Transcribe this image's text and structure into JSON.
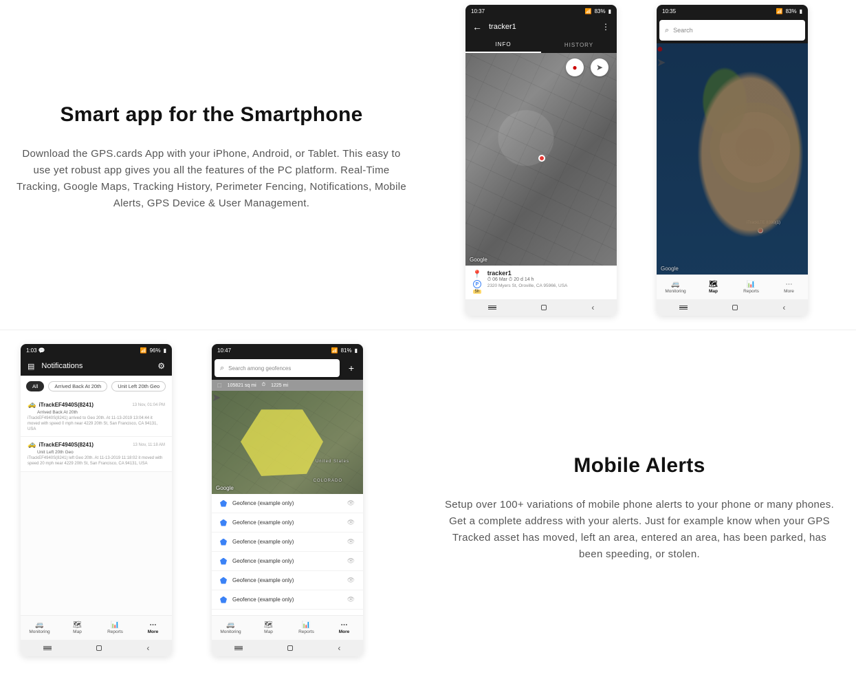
{
  "sections": {
    "s1": {
      "heading": "Smart app for the Smartphone",
      "paragraph": "Download the GPS.cards App with your iPhone, Android, or Tablet. This easy to use yet robust app gives you all the features of the PC platform. Real-Time Tracking, Google Maps, Tracking History, Perimeter Fencing, Notifications, Mobile Alerts, GPS Device & User Management."
    },
    "s2": {
      "heading": "Mobile Alerts",
      "paragraph": "Setup over 100+ variations of mobile phone alerts to your phone or many phones. Get a complete address with your alerts. Just for example know when your GPS Tracked asset has moved, left an area, entered an area, has been parked, has been speeding, or stolen."
    }
  },
  "phone1": {
    "status_time": "10:37",
    "status_batt": "83%",
    "header_title": "tracker1",
    "tab_info": "INFO",
    "tab_history": "HISTORY",
    "map_attr": "Google",
    "card_name": "tracker1",
    "card_meta": "⏱ 06 Mar  ⏱ 20 d 14 h",
    "card_addr": "2320 Myers St, Oroville, CA 95966, USA",
    "card_badge": "5h",
    "park_p": "P"
  },
  "phone2": {
    "status_time": "10:35",
    "status_batt": "83%",
    "search_placeholder": "Search",
    "map_attr": "Google",
    "tracker_label": "iTrackLTE 8390(1)",
    "nav": {
      "monitoring": "Monitoring",
      "map": "Map",
      "reports": "Reports",
      "more": "More"
    }
  },
  "phone3": {
    "status_time": "1:03",
    "status_batt": "96%",
    "header_title": "Notifications",
    "chips": {
      "all": "All",
      "c2": "Arrived Back At 20th",
      "c3": "Unit Left 20th Geo"
    },
    "notif1": {
      "title": "iTrackEF4940S(8241)",
      "ts": "13 Nov, 01:04 PM",
      "sub": "Arrived Back At 20th",
      "body": "iTrackEF4940S(8241) arrived to Geo 20th.   At 11-13-2019 13:04:44 it moved with speed 0 mph near 4229 20th St, San Francisco, CA 94131, USA"
    },
    "notif2": {
      "title": "iTrackEF4940S(8241)",
      "ts": "13 Nov, 11:18 AM",
      "sub": "Unit Left 20th Geo",
      "body": "iTrackEF4940S(8241) left Geo 20th.   At 11-13-2019 11:18:02 it moved with speed 20 mph near 4229 20th St, San Francisco, CA 94131, USA"
    },
    "nav": {
      "monitoring": "Monitoring",
      "map": "Map",
      "reports": "Reports",
      "more": "More"
    }
  },
  "phone4": {
    "status_time": "10:47",
    "status_batt": "81%",
    "search_placeholder": "Search among geofences",
    "info_area": "105821 sq mi",
    "info_len": "1225 mi",
    "map_attr": "Google",
    "state_co": "COLORADO",
    "state_us": "United States",
    "geo_name": "Geofence (example only)",
    "nav": {
      "monitoring": "Monitoring",
      "map": "Map",
      "reports": "Reports",
      "more": "More"
    }
  }
}
